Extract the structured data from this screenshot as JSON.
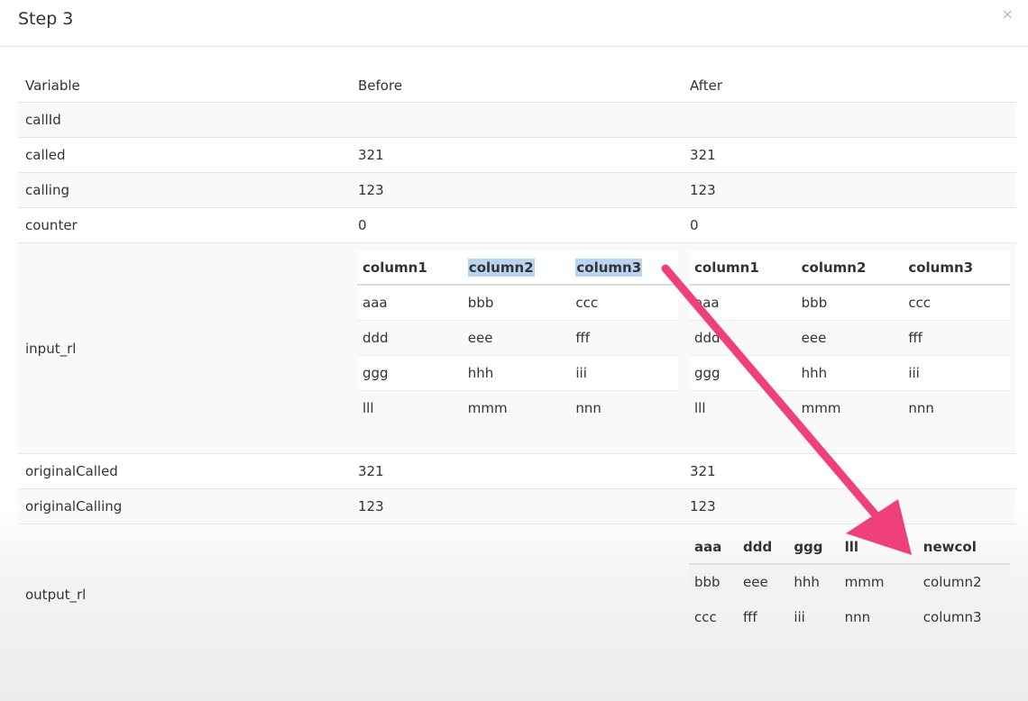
{
  "modal": {
    "title": "Step 3",
    "close_label": "×"
  },
  "table": {
    "headers": {
      "variable": "Variable",
      "before": "Before",
      "after": "After"
    },
    "rows": [
      {
        "variable": "callId",
        "before": "",
        "after": ""
      },
      {
        "variable": "called",
        "before": "321",
        "after": "321"
      },
      {
        "variable": "calling",
        "before": "123",
        "after": "123"
      },
      {
        "variable": "counter",
        "before": "0",
        "after": "0"
      }
    ],
    "input_rl": {
      "variable": "input_rl",
      "before": {
        "columns": [
          "column1",
          "column2",
          "column3"
        ],
        "rows": [
          [
            "aaa",
            "bbb",
            "ccc"
          ],
          [
            "ddd",
            "eee",
            "fff"
          ],
          [
            "ggg",
            "hhh",
            "iii"
          ],
          [
            "lll",
            "mmm",
            "nnn"
          ]
        ]
      },
      "after": {
        "columns": [
          "column1",
          "column2",
          "column3"
        ],
        "rows": [
          [
            "aaa",
            "bbb",
            "ccc"
          ],
          [
            "ddd",
            "eee",
            "fff"
          ],
          [
            "ggg",
            "hhh",
            "iii"
          ],
          [
            "lll",
            "mmm",
            "nnn"
          ]
        ]
      }
    },
    "rows_after": [
      {
        "variable": "originalCalled",
        "before": "321",
        "after": "321"
      },
      {
        "variable": "originalCalling",
        "before": "123",
        "after": "123"
      }
    ],
    "output_rl": {
      "variable": "output_rl",
      "after": {
        "columns": [
          "aaa",
          "ddd",
          "ggg",
          "lll",
          "newcol"
        ],
        "rows": [
          [
            "bbb",
            "eee",
            "hhh",
            "mmm",
            "column2"
          ],
          [
            "ccc",
            "fff",
            "iii",
            "nnn",
            "column3"
          ]
        ]
      }
    }
  },
  "annotation": {
    "arrow_color": "#f0407a"
  }
}
